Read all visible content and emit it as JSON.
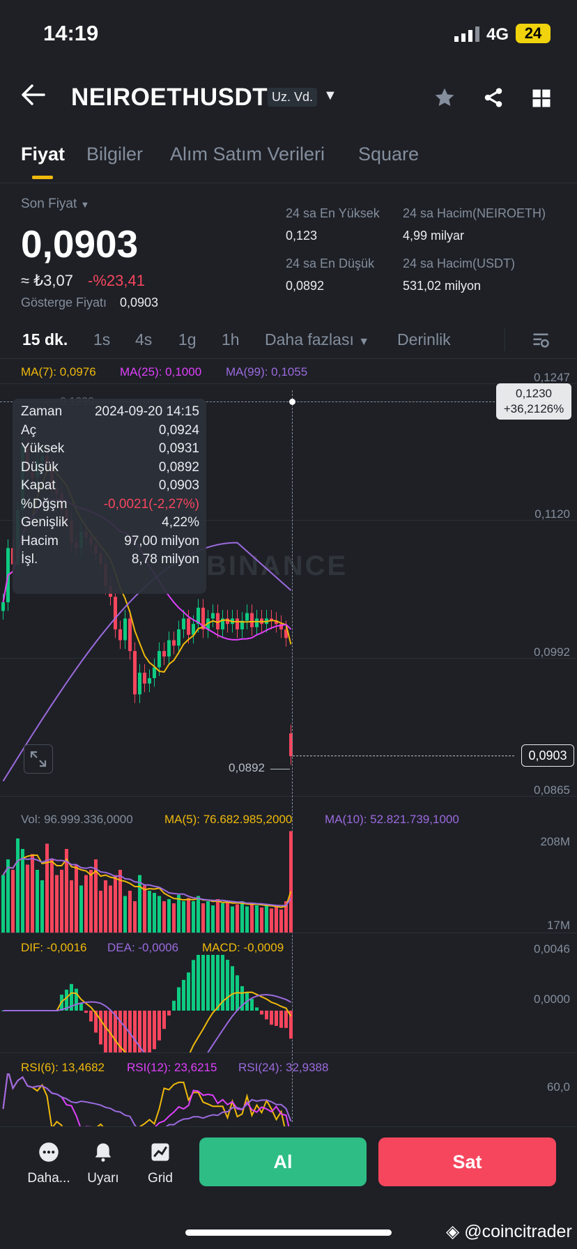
{
  "status": {
    "time": "14:19",
    "network": "4G",
    "battery": "24"
  },
  "header": {
    "pair": "NEIROETHUSDT",
    "contract_type": "Uz. Vd."
  },
  "icons": {
    "back": "back-arrow-icon",
    "favorite": "star-icon",
    "share": "share-icon",
    "layout": "grid-layout-icon"
  },
  "tabs": [
    "Fiyat",
    "Bilgiler",
    "Alım Satım Verileri",
    "Square"
  ],
  "ticker": {
    "last_label": "Son Fiyat",
    "last_price": "0,0903",
    "fiat": "≈ ₺3,07",
    "change": "-%23,41",
    "index_label": "Gösterge Fiyatı",
    "index_price": "0,0903",
    "high_label": "24 sa En Yüksek",
    "high": "0,123",
    "low_label": "24 sa En Düşük",
    "low": "0,0892",
    "vol_base_label": "24 sa Hacim(NEIROETH)",
    "vol_base": "4,99 milyar",
    "vol_quote_label": "24 sa Hacim(USDT)",
    "vol_quote": "531,02 milyon"
  },
  "timeframes": {
    "items": [
      "15 dk.",
      "1s",
      "4s",
      "1g",
      "1h"
    ],
    "more": "Daha fazlası",
    "depth": "Derinlik"
  },
  "colors": {
    "up": "#0ecb81",
    "down": "#f6465d",
    "accent": "#f0b90b",
    "ma7": "#f0b90b",
    "ma25": "#e040fb",
    "ma99": "#9c6ade"
  },
  "chart_data": [
    {
      "type": "candlestick",
      "ma_labels": {
        "ma7": "MA(7): 0,0976",
        "ma25": "MA(25): 0,1000",
        "ma99": "MA(99): 0,1055"
      },
      "y_ticks": [
        "0,1247",
        "0,1120",
        "0,0992",
        "0,0865"
      ],
      "ylim": [
        0.0865,
        0.1247
      ],
      "crosshair_price": "0,1230",
      "crosshair_change": "+36,2126%",
      "crosshair_faint": "0,1230",
      "last_price_tag": "0,0903",
      "low_marker": "0,0892",
      "watermark": "BINANCE",
      "tooltip": [
        {
          "k": "Zaman",
          "v": "2024-09-20 14:15"
        },
        {
          "k": "Aç",
          "v": "0,0924"
        },
        {
          "k": "Yüksek",
          "v": "0,0931"
        },
        {
          "k": "Düşük",
          "v": "0,0892"
        },
        {
          "k": "Kapat",
          "v": "0,0903"
        },
        {
          "k": "%Dğşm",
          "v": "-0,0021(-2,27%)"
        },
        {
          "k": "Genişlik",
          "v": "4,22%"
        },
        {
          "k": "Hacim",
          "v": "97,00 milyon"
        },
        {
          "k": "İşl.",
          "v": "8,78 milyon"
        }
      ],
      "candles_close": [
        0.1045,
        0.1095,
        0.108,
        0.113,
        0.119,
        0.1165,
        0.116,
        0.1175,
        0.118,
        0.117,
        0.115,
        0.1145,
        0.113,
        0.112,
        0.11,
        0.1095,
        0.111,
        0.1105,
        0.1098,
        0.109,
        0.108,
        0.106,
        0.105,
        0.102,
        0.101,
        0.103,
        0.1,
        0.096,
        0.098,
        0.097,
        0.0975,
        0.0985,
        0.1,
        0.0995,
        0.101,
        0.1005,
        0.102,
        0.103,
        0.1015,
        0.1025,
        0.104,
        0.102,
        0.103,
        0.1035,
        0.102,
        0.103,
        0.1025,
        0.103,
        0.102,
        0.1028,
        0.1035,
        0.1022,
        0.103,
        0.1025,
        0.103,
        0.1028,
        0.1025,
        0.102,
        0.1012,
        0.0903
      ]
    },
    {
      "type": "bar",
      "name": "volume",
      "label_vol": "Vol: 96.999.336,0000",
      "label_ma5": "MA(5): 76.682.985,2000",
      "label_ma10": "MA(10): 52.821.739,1000",
      "y_ticks": [
        "208M",
        "17M"
      ],
      "values": [
        55,
        70,
        60,
        90,
        80,
        65,
        75,
        60,
        50,
        85,
        70,
        55,
        60,
        80,
        50,
        65,
        45,
        55,
        60,
        70,
        40,
        50,
        45,
        55,
        60,
        35,
        40,
        30,
        55,
        45,
        40,
        38,
        35,
        30,
        32,
        28,
        36,
        30,
        33,
        30,
        35,
        28,
        30,
        26,
        32,
        28,
        30,
        25,
        27,
        30,
        25,
        28,
        26,
        24,
        27,
        23,
        25,
        22,
        30,
        97
      ]
    },
    {
      "type": "line",
      "name": "macd",
      "label_dif": "DIF: -0,0016",
      "label_dea": "DEA: -0,0006",
      "label_macd": "MACD: -0,0009",
      "y_ticks": [
        "0,0046",
        "0,0000"
      ]
    },
    {
      "type": "line",
      "name": "rsi",
      "label_rsi6": "RSI(6): 13,4682",
      "label_rsi12": "RSI(12): 23,6215",
      "label_rsi24": "RSI(24): 32,9388",
      "y_ticks": [
        "60,0"
      ]
    }
  ],
  "bottom": {
    "more": "Daha...",
    "alert": "Uyarı",
    "grid": "Grid",
    "buy": "Al",
    "sell": "Sat"
  },
  "watermark_user": "@coincitrader"
}
